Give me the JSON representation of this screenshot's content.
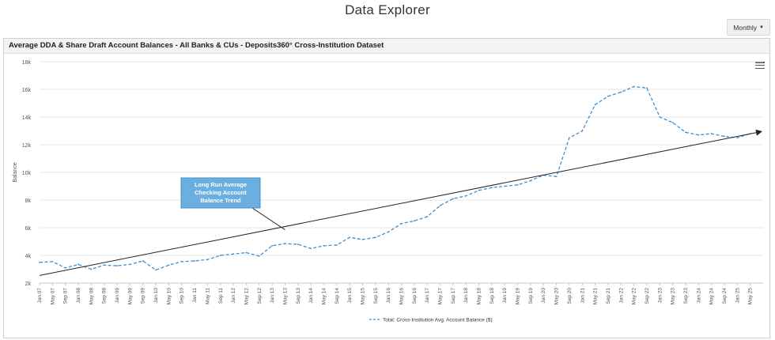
{
  "page": {
    "title": "Data Explorer"
  },
  "controls": {
    "period_label": "Monthly"
  },
  "panel": {
    "title": "Average DDA & Share Draft Account Balances - All Banks & CUs - Deposits360° Cross-Institution Dataset"
  },
  "icons": {
    "menu": "hamburger-menu-icon",
    "dropdown": "caret-down-icon"
  },
  "chart_data": {
    "type": "line",
    "title": "Average DDA & Share Draft Account Balances - All Banks & CUs - Deposits360° Cross-Institution Dataset",
    "ylabel": "Balance",
    "xlabel": "",
    "ylim": [
      2000,
      18000
    ],
    "yticks": [
      2000,
      4000,
      6000,
      8000,
      10000,
      12000,
      14000,
      16000,
      18000
    ],
    "ytick_labels": [
      "2k",
      "4k",
      "6k",
      "8k",
      "10k",
      "12k",
      "14k",
      "16k",
      "18k"
    ],
    "x_range": [
      "Jan 07",
      "Sep 25"
    ],
    "xtick_labels": [
      "Jan 07",
      "May 07",
      "Sep 07",
      "Jan 08",
      "May 08",
      "Sep 08",
      "Jan 09",
      "May 09",
      "Sep 09",
      "Jan 10",
      "May 10",
      "Sep 10",
      "Jan 11",
      "May 11",
      "Sep 11",
      "Jan 12",
      "May 12",
      "Sep 12",
      "Jan 13",
      "May 13",
      "Sep 13",
      "Jan 14",
      "May 14",
      "Sep 14",
      "Jan 15",
      "May 15",
      "Sep 15",
      "Jan 16",
      "May 16",
      "Sep 16",
      "Jan 17",
      "May 17",
      "Sep 17",
      "Jan 18",
      "May 18",
      "Sep 18",
      "Jan 19",
      "May 19",
      "Sep 19",
      "Jan 20",
      "May 20",
      "Sep 20",
      "Jan 21",
      "May 21",
      "Sep 21",
      "Jan 22",
      "May 22",
      "Sep 22",
      "Jan 23",
      "May 23",
      "Sep 23",
      "Jan 24",
      "May 24",
      "Sep 24",
      "Jan 25",
      "May 25"
    ],
    "grid": true,
    "legend_position": "bottom-center",
    "series": [
      {
        "name": "Total: Cross-Institution Avg. Account Balance ($)",
        "color": "#3d8fd6",
        "style": "dashed",
        "points": [
          [
            "Jan 07",
            3500
          ],
          [
            "May 07",
            3550
          ],
          [
            "Sep 07",
            3100
          ],
          [
            "Jan 08",
            3350
          ],
          [
            "May 08",
            3000
          ],
          [
            "Sep 08",
            3300
          ],
          [
            "Jan 09",
            3250
          ],
          [
            "May 09",
            3350
          ],
          [
            "Sep 09",
            3600
          ],
          [
            "Jan 10",
            2950
          ],
          [
            "May 10",
            3300
          ],
          [
            "Sep 10",
            3550
          ],
          [
            "Jan 11",
            3600
          ],
          [
            "May 11",
            3700
          ],
          [
            "Sep 11",
            4000
          ],
          [
            "Jan 12",
            4100
          ],
          [
            "May 12",
            4200
          ],
          [
            "Sep 12",
            3950
          ],
          [
            "Jan 13",
            4700
          ],
          [
            "May 13",
            4850
          ],
          [
            "Sep 13",
            4800
          ],
          [
            "Jan 14",
            4500
          ],
          [
            "May 14",
            4700
          ],
          [
            "Sep 14",
            4750
          ],
          [
            "Jan 15",
            5300
          ],
          [
            "May 15",
            5150
          ],
          [
            "Sep 15",
            5300
          ],
          [
            "Jan 16",
            5700
          ],
          [
            "May 16",
            6300
          ],
          [
            "Sep 16",
            6500
          ],
          [
            "Jan 17",
            6800
          ],
          [
            "May 17",
            7600
          ],
          [
            "Sep 17",
            8100
          ],
          [
            "Jan 18",
            8300
          ],
          [
            "May 18",
            8700
          ],
          [
            "Sep 18",
            8900
          ],
          [
            "Jan 19",
            9000
          ],
          [
            "May 19",
            9100
          ],
          [
            "Sep 19",
            9400
          ],
          [
            "Jan 20",
            9800
          ],
          [
            "May 20",
            9700
          ],
          [
            "Sep 20",
            12500
          ],
          [
            "Jan 21",
            13000
          ],
          [
            "May 21",
            14900
          ],
          [
            "Sep 21",
            15500
          ],
          [
            "Jan 22",
            15800
          ],
          [
            "May 22",
            16200
          ],
          [
            "Sep 22",
            16100
          ],
          [
            "Jan 23",
            14000
          ],
          [
            "May 23",
            13600
          ],
          [
            "Sep 23",
            12900
          ],
          [
            "Jan 24",
            12700
          ],
          [
            "May 24",
            12800
          ],
          [
            "Sep 24",
            12600
          ],
          [
            "Jan 25",
            12500
          ],
          [
            "May 25",
            12800
          ]
        ]
      }
    ],
    "trendline": {
      "color": "#222222",
      "start": [
        "Jan 07",
        2550
      ],
      "end": [
        "Sep 25",
        12950
      ],
      "arrow": true
    },
    "annotation": {
      "text": "Long Run Average Checking Account Balance Trend",
      "fill": "#6aafdf",
      "border": "#4a90c8",
      "target": [
        "May 13",
        5850
      ]
    }
  }
}
